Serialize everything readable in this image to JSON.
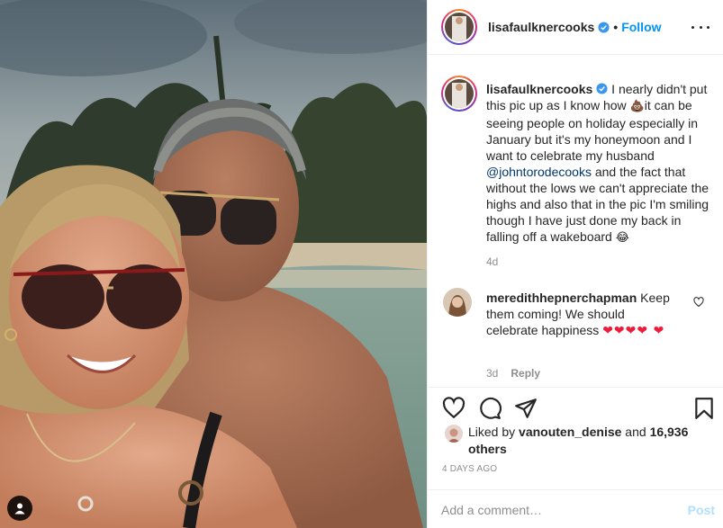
{
  "post": {
    "username": "lisafaulknercooks",
    "follow_label": "Follow",
    "separator": "•"
  },
  "caption": {
    "username": "lisafaulknercooks",
    "text_part1": " I nearly didn't put this pic up as I know how ",
    "emoji1": "💩",
    "text_part2": "it can be seeing people on holiday especially in January but it's my honeymoon and I want to celebrate my husband ",
    "mention": "@johntorodecooks",
    "text_part3": " and the fact that without the lows we can't appreciate the highs and also that in the pic I'm smiling though I have just done my back in falling off a wakeboard ",
    "emoji2": "😂",
    "time": "4d"
  },
  "comment": {
    "username": "meredithhepnerchapman",
    "text": " Keep them coming! We should celebrate happiness ",
    "hearts": "❤❤❤❤ ❤",
    "time": "3d",
    "reply_label": "Reply"
  },
  "likes": {
    "prefix": "Liked by ",
    "user": "vanouten_denise",
    "middle": " and ",
    "count": "16,936 others"
  },
  "date": "4 DAYS AGO",
  "add_comment": {
    "placeholder": "Add a comment…",
    "post_label": "Post"
  },
  "icons": {
    "verified": "verified-badge-icon",
    "like": "heart-icon",
    "comment": "comment-icon",
    "share": "paper-plane-icon",
    "save": "bookmark-icon",
    "more": "more-options-icon",
    "tag": "person-tag-icon"
  },
  "colors": {
    "accent": "#0095f6",
    "verified": "#3897f0",
    "post_disabled": "#b2dffc",
    "muted": "#8e8e8e",
    "mention": "#00376b"
  }
}
